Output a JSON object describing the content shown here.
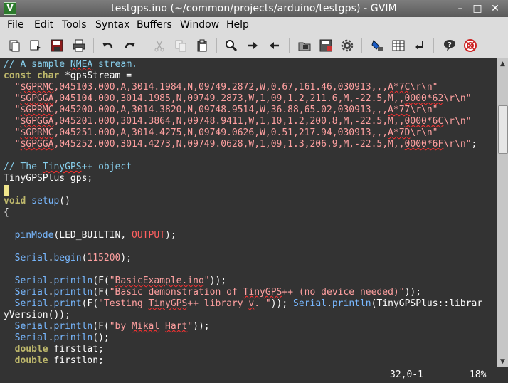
{
  "window": {
    "title": "testgps.ino (~/common/projects/arduino/testgps) - GVIM",
    "app_icon_glyph": "V",
    "minimize_glyph": "–",
    "maximize_glyph": "□",
    "close_glyph": "✕"
  },
  "menubar": [
    "File",
    "Edit",
    "Tools",
    "Syntax",
    "Buffers",
    "Window",
    "Help"
  ],
  "toolbar": {
    "icons": [
      "open-icon",
      "save-icon",
      "save-all-icon",
      "print-icon",
      "undo-icon",
      "redo-icon",
      "cut-icon",
      "copy-icon",
      "paste-icon",
      "find-icon",
      "find-next-icon",
      "find-previous-icon",
      "load-session-icon",
      "save-session-icon",
      "run-script-icon",
      "make-icon",
      "shell-icon",
      "run-ctags-icon",
      "jump-to-tag-icon",
      "help-icon",
      "find-help-icon"
    ]
  },
  "colors": {
    "editor_background": "#333333",
    "comment": "#87ceeb",
    "type": "#bdb76b",
    "string": "#ffa0a0",
    "function": "#78b8ff",
    "constant": "#ff6060",
    "cursor": "#f0e68c"
  },
  "editor": {
    "lines": {
      "l01": {
        "a": "// A sample ",
        "b": "NMEA",
        "c": " stream."
      },
      "l02": {
        "a": "const char",
        "b": " *gpsStream ="
      },
      "l03": {
        "a": "  \"",
        "b": "$GPRMC",
        "c": ",045103.000,A,3014.1984,N,09749.2872,W,0.67,161.46,030913,,,",
        "d": "A*7C",
        "e": "\\r\\n\""
      },
      "l04": {
        "a": "  \"",
        "b": "$GPGGA",
        "c": ",045104.000,3014.1985,N,09749.2873,W,1,09,1.2,211.6,M,-22.5,M,,",
        "d": "0000*62",
        "e": "\\r\\n\""
      },
      "l05": {
        "a": "  \"",
        "b": "$GPRMC",
        "c": ",045200.000,A,3014.3820,N,09748.9514,W,36.88,65.02,030913,,,",
        "d": "A*77",
        "e": "\\r\\n\""
      },
      "l06": {
        "a": "  \"",
        "b": "$GPGGA",
        "c": ",045201.000,3014.3864,N,09748.9411,W,1,10,1.2,200.8,M,-22.5,M,,",
        "d": "0000*6C",
        "e": "\\r\\n\""
      },
      "l07": {
        "a": "  \"",
        "b": "$GPRMC",
        "c": ",045251.000,A,3014.4275,N,09749.0626,W,0.51,217.94,030913,,,",
        "d": "A*7D",
        "e": "\\r\\n\""
      },
      "l08": {
        "a": "  \"",
        "b": "$GPGGA",
        "c": ",045252.000,3014.4273,N,09749.0628,W,1,09,1.3,206.9,M,-22.5,M,,",
        "d": "0000*6F",
        "e": "\\r\\n\"",
        "f": ";"
      },
      "l10": {
        "a": "// The ",
        "b": "TinyGPS",
        "c": "++ object"
      },
      "l11": {
        "a": "TinyGPSPlus gps;"
      },
      "l13": {
        "a": "void",
        "b": " ",
        "c": "setup",
        "d": "()"
      },
      "l14": {
        "a": "{"
      },
      "l16": {
        "a": "  ",
        "b": "pinMode",
        "c": "(LED_BUILTIN, ",
        "d": "OUTPUT",
        "e": ");"
      },
      "l18": {
        "a": "  ",
        "b": "Serial",
        "c": ".",
        "d": "begin",
        "e": "(",
        "f": "115200",
        "g": ");"
      },
      "l20": {
        "a": "  ",
        "b": "Serial",
        "c": ".",
        "d": "println",
        "e": "(F(",
        "f": "\"",
        "g": "BasicExample.ino",
        "h": "\"",
        "i": "));"
      },
      "l21": {
        "a": "  ",
        "b": "Serial",
        "c": ".",
        "d": "println",
        "e": "(F(",
        "f": "\"Basic demonstration of ",
        "g": "TinyGPS",
        "h": "++ (no device needed)\"",
        "i": "));"
      },
      "l22": {
        "a": "  ",
        "b": "Serial",
        "c": ".",
        "d": "print",
        "e": "(F(",
        "f": "\"Testing ",
        "g": "TinyGPS",
        "h": "++ library ",
        "i": "v",
        "j": ". \"",
        "k": ")); ",
        "l": "Serial",
        "m": ".",
        "n": "println",
        "o": "(TinyGPSPlus::librar"
      },
      "l23": {
        "a": "yVersion());"
      },
      "l24": {
        "a": "  ",
        "b": "Serial",
        "c": ".",
        "d": "println",
        "e": "(F(",
        "f": "\"by ",
        "g": "Mikal",
        "h": " ",
        "i": "Hart",
        "j": "\"",
        "k": "));"
      },
      "l25": {
        "a": "  ",
        "b": "Serial",
        "c": ".",
        "d": "println",
        "e": "();"
      },
      "l26": {
        "a": "  ",
        "b": "double",
        "c": " firstlat;"
      },
      "l27": {
        "a": "  ",
        "b": "double",
        "c": " firstlon;"
      }
    }
  },
  "status": {
    "position": "32,0-1",
    "percent": "18%"
  },
  "scrollbar": {
    "position_fraction": 0.18,
    "up_glyph": "▲",
    "down_glyph": "▼"
  }
}
